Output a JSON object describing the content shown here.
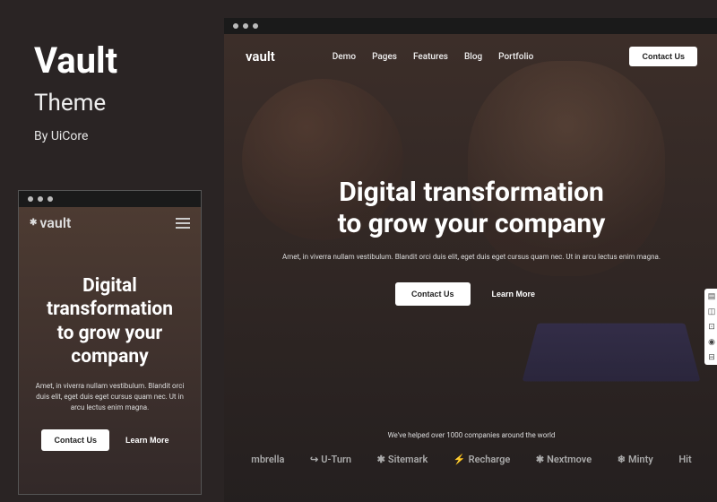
{
  "info": {
    "title": "Vault",
    "subtitle": "Theme",
    "byline": "By UiCore"
  },
  "hero": {
    "logo": "vault",
    "headline_line1": "Digital transformation",
    "headline_line2": "to grow your company",
    "subtext": "Amet, in viverra nullam vestibulum. Blandit orci duis elit, eget duis eget cursus quam nec. Ut in arcu lectus enim magna.",
    "cta_primary": "Contact Us",
    "cta_secondary": "Learn More"
  },
  "nav": {
    "items": [
      "Demo",
      "Pages",
      "Features",
      "Blog",
      "Portfolio"
    ],
    "header_cta": "Contact Us"
  },
  "social_proof": {
    "text": "We've helped over 1000 companies around the world",
    "logos": [
      "mbrella",
      "U-Turn",
      "Sitemark",
      "Recharge",
      "Nextmove",
      "Minty",
      "Hit"
    ]
  },
  "side_tools": [
    "▤",
    "◫",
    "⊡",
    "◉",
    "⊟"
  ]
}
